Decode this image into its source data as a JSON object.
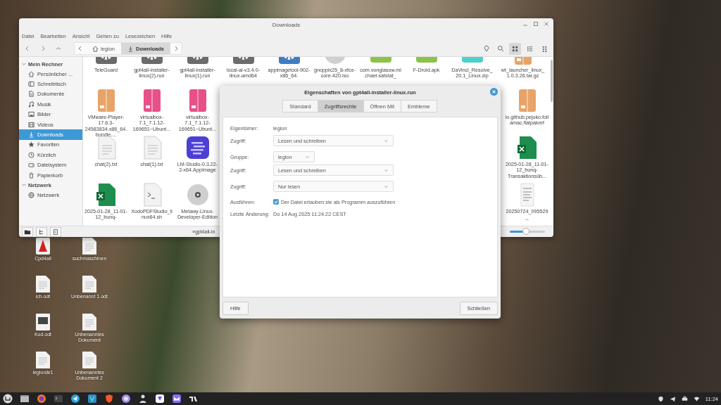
{
  "desktop": {
    "icons": [
      {
        "label": "Cpd4all",
        "kind": "app"
      },
      {
        "label": "suchmaschinen",
        "kind": "document"
      },
      {
        "label": "ich.odt",
        "kind": "document"
      },
      {
        "label": "Unbenannt 1.odt",
        "kind": "document"
      },
      {
        "label": "Kod.odt",
        "kind": "image-document"
      },
      {
        "label": "Unbenanntes Dokument",
        "kind": "document"
      },
      {
        "label": "legionär1",
        "kind": "document"
      },
      {
        "label": "Unbenanntes Dokument 2",
        "kind": "document"
      }
    ]
  },
  "file_manager": {
    "title": "Downloads",
    "menu": [
      "Datei",
      "Bearbeiten",
      "Ansicht",
      "Gehen zu",
      "Lesezeichen",
      "Hilfe"
    ],
    "breadcrumb": [
      {
        "label": "legion",
        "kind": "home",
        "selected": false
      },
      {
        "label": "Downloads",
        "kind": "download",
        "selected": true
      }
    ],
    "view_modes": [
      {
        "kind": "icons",
        "selected": true
      },
      {
        "kind": "list",
        "selected": false
      },
      {
        "kind": "compact",
        "selected": false
      }
    ],
    "sidebar": [
      {
        "title": "Mein Rechner",
        "expanded": true,
        "items": [
          {
            "label": "Persönlicher ...",
            "kind": "home",
            "selected": false
          },
          {
            "label": "Schreibtisch",
            "kind": "desktop",
            "selected": false
          },
          {
            "label": "Dokumente",
            "kind": "document",
            "selected": false
          },
          {
            "label": "Musik",
            "kind": "music",
            "selected": false
          },
          {
            "label": "Bilder",
            "kind": "picture",
            "selected": false
          },
          {
            "label": "Videos",
            "kind": "video",
            "selected": false
          },
          {
            "label": "Downloads",
            "kind": "download",
            "selected": true
          },
          {
            "label": "Favoriten",
            "kind": "star",
            "selected": false
          },
          {
            "label": "Kürzlich",
            "kind": "clock",
            "selected": false
          },
          {
            "label": "Dateisystem",
            "kind": "drive",
            "selected": false
          },
          {
            "label": "Papierkorb",
            "kind": "trash",
            "selected": false
          }
        ]
      },
      {
        "title": "Netzwerk",
        "expanded": true,
        "items": [
          {
            "label": "Netzwerk",
            "kind": "network",
            "selected": false
          }
        ]
      }
    ],
    "rows": [
      {
        "left": [
          {
            "name": "TeleGuard",
            "kind": "executable"
          },
          {
            "name": "gpt4all-installer-linux(2).run",
            "kind": "executable"
          },
          {
            "name": "gpt4all-installer-linux(1).run",
            "kind": "executable"
          },
          {
            "name": "local-ai-v3.4.0-linux-amd64",
            "kind": "executable"
          },
          {
            "name": "appimagetool-902-x86_64.",
            "kind": "appimage"
          },
          {
            "name": "gnoppix25_8-xfce-core-420.iso",
            "kind": "disc"
          },
          {
            "name": "com.vonglasow.michael.satstat_",
            "kind": "apk"
          },
          {
            "name": "F-Droid.apk",
            "kind": "apk"
          },
          {
            "name": "DaVinci_Resolve_20.1_Linux.zip",
            "kind": "zip"
          },
          {
            "name": "wt_launcher_linux_1.0.3.26.tar.gz",
            "kind": "package"
          }
        ],
        "right": []
      },
      {
        "left": [
          {
            "name": "VMware-Player-17.6.3-24583834.x86_64.bundle....",
            "kind": "package"
          },
          {
            "name": "virtualbox-7.1_7.1.12-169651~Ubunt...",
            "kind": "deb"
          },
          {
            "name": "virtualbox-7.1_7.1.12-169651~Ubunt...",
            "kind": "deb"
          }
        ],
        "right": [
          {
            "name": "io.github.pejuko.follamac.flatpakref",
            "kind": "package"
          }
        ]
      },
      {
        "left": [
          {
            "name": "chat(2).txt",
            "kind": "text"
          },
          {
            "name": "chat(1).txt",
            "kind": "text"
          },
          {
            "name": "LM-Studio-0.3.22-2-x64.AppImage",
            "kind": "lmstudio"
          }
        ],
        "right": [
          {
            "name": "2025-01-28_11-01-12_bunq-Transaktionsüb...",
            "kind": "spreadsheet"
          }
        ]
      },
      {
        "left": [
          {
            "name": "2025-01-28_11-01-12_bunq-",
            "kind": "spreadsheet"
          },
          {
            "name": "XodoPDFStudio_linux64.sh",
            "kind": "script"
          },
          {
            "name": "Melawy-Linux-Developer-Edition",
            "kind": "disc"
          }
        ],
        "right": [
          {
            "name": "20250724_095529_",
            "kind": "scan"
          }
        ]
      }
    ],
    "status": "»gpt4all-in",
    "zoom": {
      "level": 0.45
    }
  },
  "dialog": {
    "title": "Eigenschaften von gpt4all-installer-linux.run",
    "tabs": [
      {
        "label": "Standard",
        "selected": false
      },
      {
        "label": "Zugriffsrechte",
        "selected": true
      },
      {
        "label": "Öffnen Mit",
        "selected": false
      },
      {
        "label": "Embleme",
        "selected": false
      }
    ],
    "groups": [
      [
        {
          "label": "Eigentümer:",
          "kind": "text",
          "value": "legion"
        },
        {
          "label": "Zugriff:",
          "kind": "dropdown",
          "value": "Lesen und schreiben"
        }
      ],
      [
        {
          "label": "Gruppe:",
          "kind": "small-dropdown",
          "value": "legion"
        },
        {
          "label": "Zugriff:",
          "kind": "dropdown",
          "value": "Lesen und schreiben"
        }
      ],
      [
        {
          "label": "Zugriff:",
          "kind": "dropdown",
          "value": "Nur lesen"
        }
      ],
      [
        {
          "label": "Ausführen:",
          "kind": "checkbox",
          "value": "Der Datei erlauben sie als Programm auszuführen",
          "checked": true
        },
        {
          "label": "Letzte Änderung:",
          "kind": "text",
          "value": "Do 14 Aug 2025 11:24:22 CEST"
        }
      ]
    ],
    "buttons": [
      "Hilfe",
      "Schließen"
    ]
  },
  "taskbar": {
    "apps": [
      {
        "kind": "menu"
      },
      {
        "kind": "files"
      },
      {
        "kind": "browser"
      },
      {
        "kind": "terminal"
      },
      {
        "kind": "messenger"
      },
      {
        "kind": "editor"
      },
      {
        "kind": "lion"
      },
      {
        "kind": "orb"
      },
      {
        "kind": "person"
      },
      {
        "kind": "vpn"
      },
      {
        "kind": "mail"
      },
      {
        "kind": "chart"
      }
    ],
    "tray": [
      {
        "kind": "shield"
      },
      {
        "kind": "messenger"
      },
      {
        "kind": "printer"
      },
      {
        "kind": "wifi"
      }
    ],
    "clock": "11:24"
  }
}
